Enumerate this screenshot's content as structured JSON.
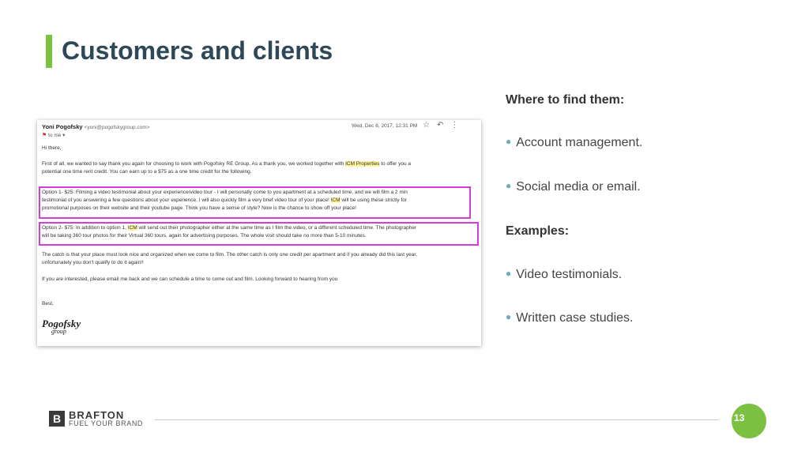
{
  "slide": {
    "title": "Customers and clients",
    "page_number": "13"
  },
  "email": {
    "sender": "Yoni Pogofsky",
    "address": "<yoni@pogofskygroup.com>",
    "to": "to me",
    "date": "Wed, Dec 6, 2017, 12:31 PM",
    "greeting": "Hi there,",
    "p1_a": "First of all, we wanted to say thank you again for choosing to work with Pogofsky RE Group.  As a thank you, we worked together with ",
    "p1_hl": "ICM Properties",
    "p1_b": " to offer you a",
    "p1_line2": "potential one time rent credit.  You can earn up to a $75 as a one time credit for the following.",
    "opt1_line1": "Option 1- $25: Filming a video testimonial about your experience/video tour - I will personally come to you apartment at a scheduled time, and we will film a 2 min",
    "opt1_line2_a": "testimonial of you answering a few questions about your experience.  I will also quickly film a very brief video tour of your place!  ",
    "opt1_line2_hl": "ICM",
    "opt1_line2_b": " will be using these strictly for",
    "opt1_line3": "promotional purposes on their website and their youtube page.  Think you have a sense of style?  Now is the chance to show off your place!",
    "opt2_line1_a": "Option 2- $75:  In addition to option 1, ",
    "opt2_line1_hl": "ICM",
    "opt2_line1_b": " will send out their photographer either at the same time as I film the video, or a different scheduled time.  The photographer",
    "opt2_line2": "will be taking 360 tour photos for their Virtual 360 tours, again for advertising purposes.  The whole visit should take no more than 5-10 minutes.",
    "catch_line1": "The catch is that your place must look nice and organized when we come to film.  The other catch is only one credit per apartment and if you already did this last year,",
    "catch_line2": "unfortunately you don't qualify to do it again!!",
    "interest_line": "If you are interested, please email me back and we can schedule a time to come out and film.  Looking forward to hearing from you",
    "signoff": "Best,",
    "sig_logo": "Pogofsky",
    "sig_logo_sub": "group"
  },
  "right": {
    "heading1": "Where to find them:",
    "bullets1": [
      "Account management.",
      "Social media or email."
    ],
    "heading2": "Examples:",
    "bullets2": [
      "Video testimonials.",
      "Written case studies."
    ]
  },
  "footer": {
    "logo_letter": "B",
    "brand": "BRAFTON",
    "tagline": "FUEL YOUR BRAND"
  },
  "colors": {
    "accent_green": "#7dc142",
    "title_color": "#2f4858",
    "highlight_box": "#d63cd6",
    "bullet_dot": "#6fa8c6"
  }
}
